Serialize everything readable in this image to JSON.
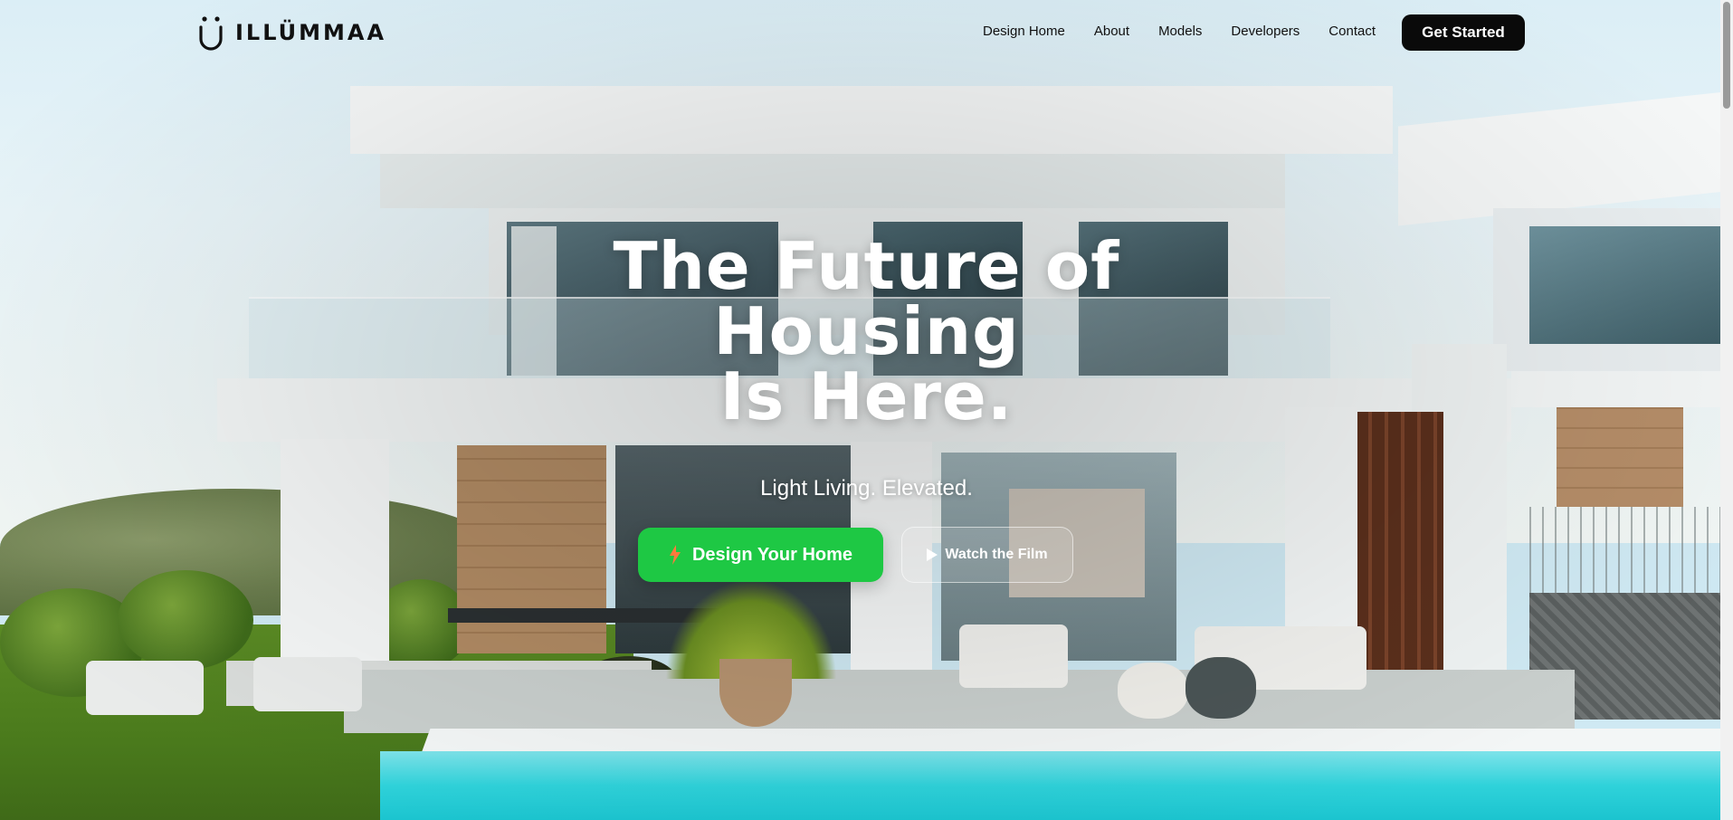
{
  "brand": {
    "name": "ILLÜMMAA",
    "logo_icon": "u-smile-icon"
  },
  "nav": {
    "items": [
      {
        "label": "Design Home"
      },
      {
        "label": "About"
      },
      {
        "label": "Models"
      },
      {
        "label": "Developers"
      },
      {
        "label": "Contact"
      }
    ],
    "cta_label": "Get Started"
  },
  "hero": {
    "headline_lines": [
      "The Future of",
      "Housing",
      "Is Here."
    ],
    "subtitle": "Light Living. Elevated.",
    "primary_cta": {
      "label": "Design Your Home",
      "icon": "lightning-bolt-icon"
    },
    "secondary_cta": {
      "label": "Watch the Film",
      "icon": "play-icon"
    }
  },
  "colors": {
    "accent_green": "#1ec844",
    "nav_button_bg": "#0a0a0a",
    "text_dark": "#111111",
    "text_light": "#ffffff"
  }
}
